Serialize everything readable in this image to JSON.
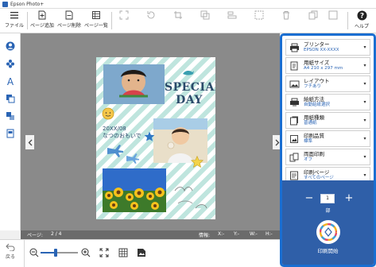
{
  "window": {
    "title": "Epson Photo+"
  },
  "toolbar": {
    "file_label": "ファイル",
    "add_page_label": "ページ追加",
    "delete_page_label": "ページ削除",
    "page_list_label": "ページ一覧",
    "help_label": "ヘルプ"
  },
  "status": {
    "page_label": "ページ:",
    "page_value": "2 / 4",
    "info_label": "情報:",
    "x_label": "X:-",
    "y_label": "Y:-",
    "w_label": "W:-",
    "h_label": "H:-"
  },
  "bottom": {
    "back_label": "戻る",
    "zoom_fraction": 0.4
  },
  "print_settings": {
    "printer": {
      "title": "プリンター",
      "value": "EPSON XX-XXXX"
    },
    "paper_size": {
      "title": "用紙サイズ",
      "value": "A4 210 x 297 mm"
    },
    "layout": {
      "title": "レイアウト",
      "value": "フチあり"
    },
    "feed": {
      "title": "給紙方法",
      "value": "自動給紙選択"
    },
    "paper_type": {
      "title": "用紙種類",
      "value": "普通紙"
    },
    "quality": {
      "title": "印刷品質",
      "value": "標準"
    },
    "duplex": {
      "title": "両面印刷",
      "value": "オフ"
    },
    "pages": {
      "title": "印刷ページ",
      "value": "すべてのページ"
    }
  },
  "print_panel": {
    "copies": "1",
    "copies_unit": "部",
    "print_label": "印刷開始"
  },
  "page_content": {
    "heading_line1": "SPECIAL",
    "heading_line2": "DAY",
    "note_line1": "20XX/08",
    "note_line2": "なつのおもいで"
  },
  "colors": {
    "accent": "#1a6ed1",
    "print_area": "#2f5fa8",
    "status_bar": "#6b6b6b"
  }
}
